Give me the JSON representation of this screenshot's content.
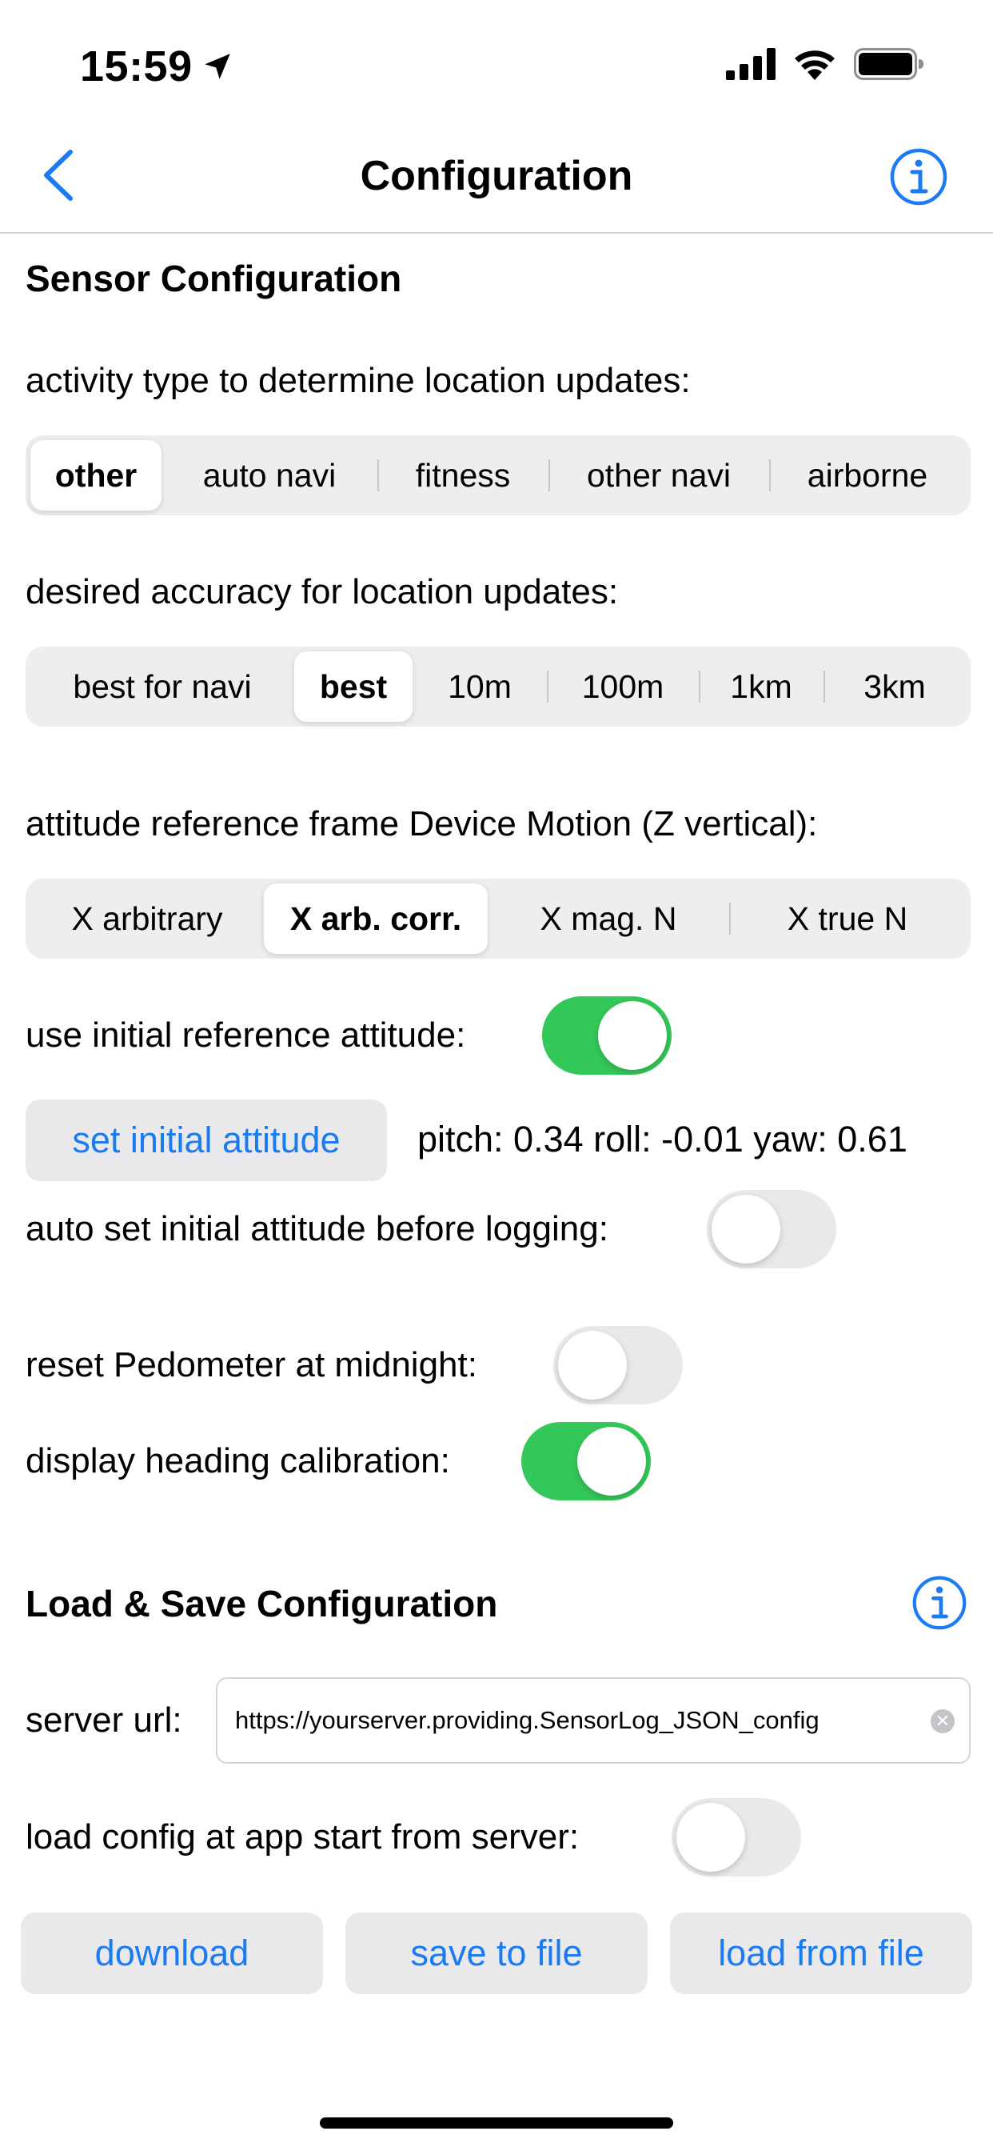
{
  "status_bar": {
    "time": "15:59"
  },
  "nav": {
    "title": "Configuration"
  },
  "sensor": {
    "section_title": "Sensor Configuration",
    "activity": {
      "label": "activity type to determine location updates:",
      "options": [
        "other",
        "auto navi",
        "fitness",
        "other navi",
        "airborne"
      ],
      "selected": "other"
    },
    "accuracy": {
      "label": "desired accuracy for location updates:",
      "options": [
        "best for navi",
        "best",
        "10m",
        "100m",
        "1km",
        "3km"
      ],
      "selected": "best"
    },
    "attitude_frame": {
      "label": "attitude reference frame Device Motion (Z vertical):",
      "options": [
        "X arbitrary",
        "X arb. corr.",
        "X mag. N",
        "X true N"
      ],
      "selected": "X arb. corr."
    },
    "use_initial_reference": {
      "label": "use initial reference attitude:",
      "on": true
    },
    "set_initial_button": "set initial attitude",
    "attitude_readout": "pitch: 0.34 roll: -0.01 yaw: 0.61",
    "auto_set_initial": {
      "label": "auto set initial attitude before logging:",
      "on": false
    },
    "reset_pedometer": {
      "label": "reset Pedometer at midnight:",
      "on": false
    },
    "heading_calibration": {
      "label": "display heading calibration:",
      "on": true
    }
  },
  "load_save": {
    "section_title": "Load & Save Configuration",
    "server_url_label": "server url:",
    "server_url_value": "https://yourserver.providing.SensorLog_JSON_config",
    "load_at_start": {
      "label": "load config at app start from server:",
      "on": false
    },
    "buttons": {
      "download": "download",
      "save": "save to file",
      "load": "load from file"
    }
  },
  "colors": {
    "accent": "#1a7bf2",
    "toggle_on": "#34c759",
    "toggle_off": "#e9e9eb",
    "segment_bg": "#eeeef0"
  },
  "icons": [
    "location-arrow-icon",
    "cellular-signal-icon",
    "wifi-icon",
    "battery-icon",
    "chevron-left-icon",
    "info-circle-icon",
    "clear-icon"
  ]
}
